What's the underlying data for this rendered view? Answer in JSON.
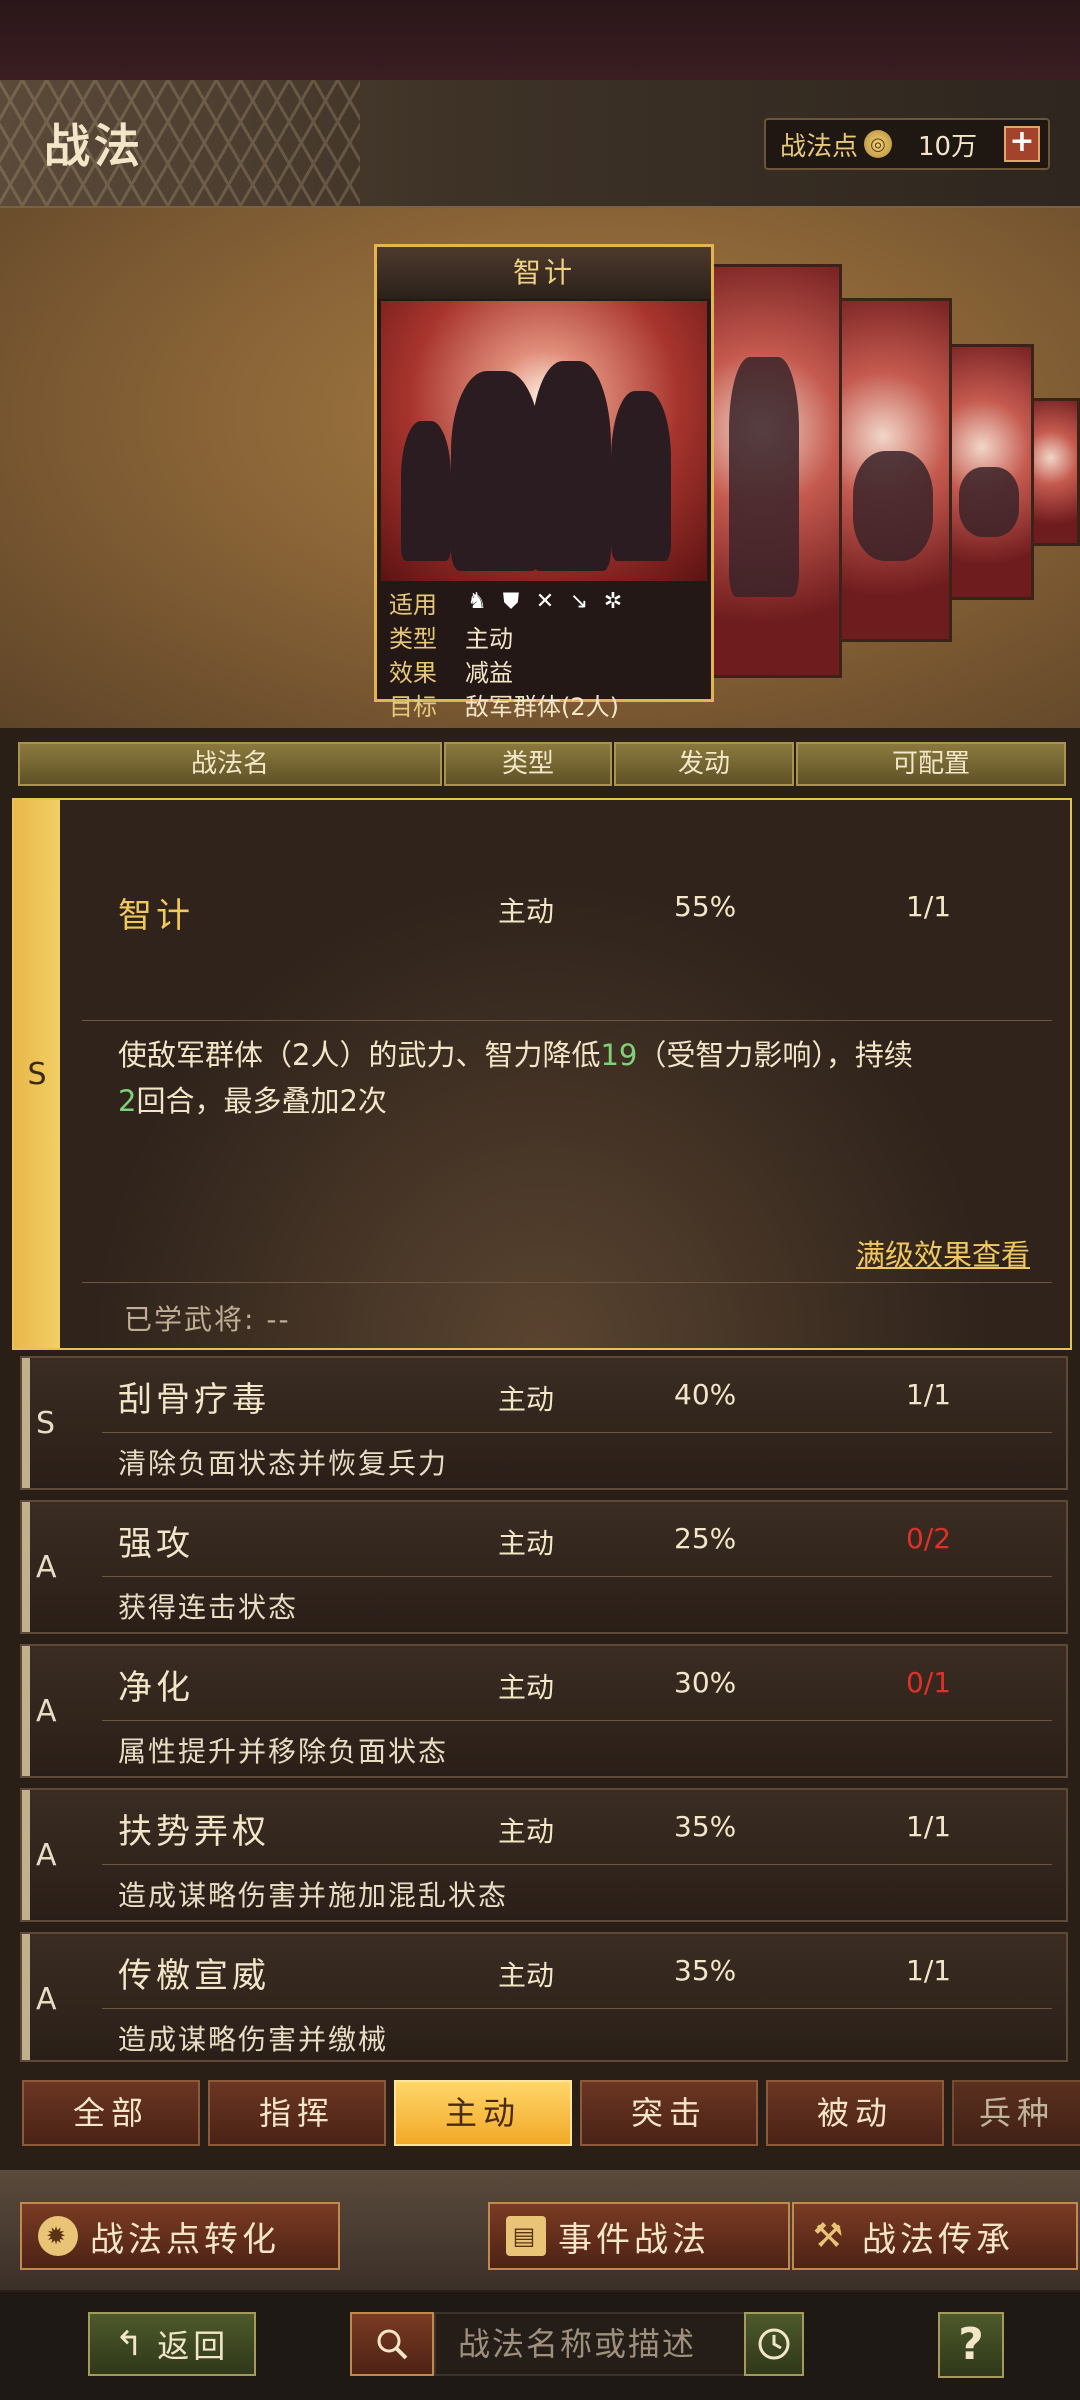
{
  "header": {
    "title": "战法",
    "points_label": "战法点",
    "points_value": "10万",
    "plus_label": "+"
  },
  "featured_card": {
    "title": "智计",
    "rows": [
      {
        "key": "适用",
        "value": ""
      },
      {
        "key": "类型",
        "value": "主动"
      },
      {
        "key": "效果",
        "value": "减益"
      },
      {
        "key": "目标",
        "value": "敌军群体(2人)"
      }
    ],
    "applicable_icons": [
      "cavalry-icon",
      "shield-icon",
      "bow-icon",
      "spear-icon",
      "wheel-icon"
    ]
  },
  "columns": [
    "战法名",
    "类型",
    "发动",
    "可配置"
  ],
  "expanded": {
    "rank": "S",
    "name": "智计",
    "type": "主动",
    "rate": "55%",
    "config": "1/1",
    "desc_part1": "使敌军群体（2人）的武力、智力降低",
    "desc_num1": "19",
    "desc_part2": "（受智力影响），持续",
    "desc_num2": "2",
    "desc_part3": "回合，最多叠加2次",
    "link": "满级效果查看",
    "learned_label": "已学武将: --"
  },
  "skills": [
    {
      "rank": "S",
      "name": "刮骨疗毒",
      "type": "主动",
      "rate": "40%",
      "config": "1/1",
      "desc": "清除负面状态并恢复兵力",
      "config_color": "#f3e6c8"
    },
    {
      "rank": "A",
      "name": "强攻",
      "type": "主动",
      "rate": "25%",
      "config": "0/2",
      "desc": "获得连击状态",
      "config_color": "#e0302a"
    },
    {
      "rank": "A",
      "name": "净化",
      "type": "主动",
      "rate": "30%",
      "config": "0/1",
      "desc": "属性提升并移除负面状态",
      "config_color": "#e0302a"
    },
    {
      "rank": "A",
      "name": "扶势弄权",
      "type": "主动",
      "rate": "35%",
      "config": "1/1",
      "desc": "造成谋略伤害并施加混乱状态",
      "config_color": "#f3e6c8"
    },
    {
      "rank": "A",
      "name": "传檄宣威",
      "type": "主动",
      "rate": "35%",
      "config": "1/1",
      "desc": "造成谋略伤害并缴械",
      "config_color": "#f3e6c8"
    }
  ],
  "tabs": [
    "全部",
    "指挥",
    "主动",
    "突击",
    "被动",
    "兵种"
  ],
  "active_tab": "主动",
  "actions": {
    "convert": "战法点转化",
    "event": "事件战法",
    "inherit": "战法传承"
  },
  "bottom": {
    "back": "返回",
    "search_placeholder": "战法名称或描述",
    "help": "?"
  }
}
